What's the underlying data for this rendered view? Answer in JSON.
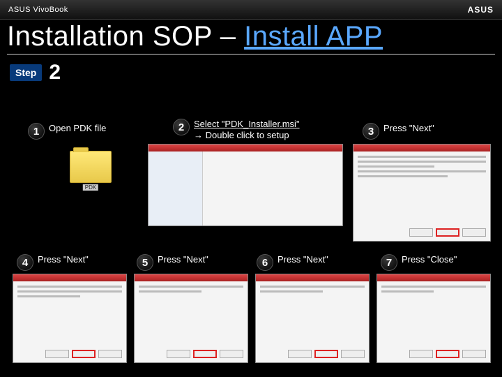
{
  "brand": {
    "product": "ASUS VivoBook",
    "logo": "ASUS"
  },
  "title": {
    "plain": "Installation SOP – ",
    "accent": "Install APP"
  },
  "step": {
    "label": "Step",
    "number": "2"
  },
  "items": {
    "n1": {
      "num": "1",
      "text": "Open PDK file",
      "folder_label": "PDK"
    },
    "n2": {
      "num": "2",
      "line1": "Select \"PDK_Installer.msi\"",
      "line2": "→ Double click to setup"
    },
    "n3": {
      "num": "3",
      "text": "Press \"Next\""
    },
    "n4": {
      "num": "4",
      "text": "Press \"Next\""
    },
    "n5": {
      "num": "5",
      "text": "Press \"Next\""
    },
    "n6": {
      "num": "6",
      "text": "Press \"Next\""
    },
    "n7": {
      "num": "7",
      "text": "Press \"Close\""
    }
  }
}
